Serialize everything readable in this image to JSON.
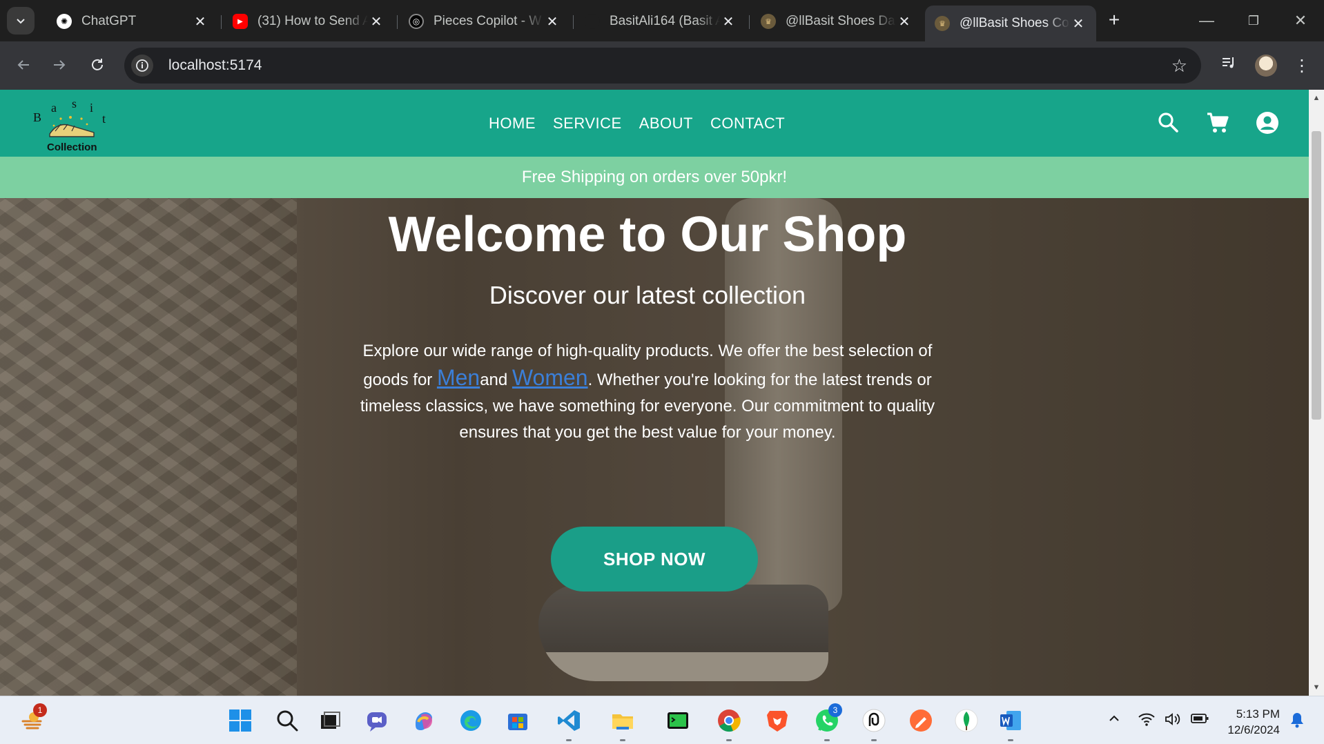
{
  "browser": {
    "tabs": [
      {
        "title": "ChatGPT",
        "icon": "chatgpt-icon",
        "active": false
      },
      {
        "title": "(31) How to Send A",
        "icon": "youtube-icon",
        "active": false
      },
      {
        "title": "Pieces Copilot - W",
        "icon": "pieces-icon",
        "active": false
      },
      {
        "title": "BasitAli164 (Basit A",
        "icon": "github-icon",
        "active": false
      },
      {
        "title": "@llBasit Shoes Das",
        "icon": "site-favicon",
        "active": false
      },
      {
        "title": "@llBasit Shoes Col",
        "icon": "site-favicon",
        "active": true
      }
    ],
    "url": "localhost:5174"
  },
  "site": {
    "logo": {
      "letters": [
        "B",
        "a",
        "s",
        "i",
        "t"
      ],
      "caption": "Collection"
    },
    "nav": [
      "HOME",
      "SERVICE",
      "ABOUT",
      "CONTACT"
    ],
    "promo": "Free Shipping on orders over 50pkr!",
    "hero": {
      "title": "Welcome to Our Shop",
      "subtitle": "Discover our latest collection",
      "body_1": "Explore our wide range of high-quality products. We offer the best selection of goods for ",
      "link_men": "Men",
      "body_2": "and ",
      "link_women": "Women",
      "body_3": ". Whether you're looking for the latest trends or timeless classics, we have something for everyone. Our commitment to quality ensures that you get the best value for your money.",
      "cta": "SHOP NOW"
    },
    "colors": {
      "header": "#17a58a",
      "promo": "#7dd0a1",
      "cta": "#1a9e88",
      "link": "#3b7fd8"
    }
  },
  "taskbar": {
    "apps": [
      "weather-widget",
      "windows-start",
      "search",
      "task-view",
      "teams-chat",
      "copilot",
      "edge",
      "microsoft-store",
      "vscode",
      "file-explorer",
      "terminal",
      "chrome",
      "brave",
      "whatsapp",
      "pieces",
      "postman",
      "mongodb-compass",
      "word"
    ],
    "widget_badge": "1",
    "whatsapp_badge": "3",
    "time": "5:13 PM",
    "date": "12/6/2024"
  }
}
